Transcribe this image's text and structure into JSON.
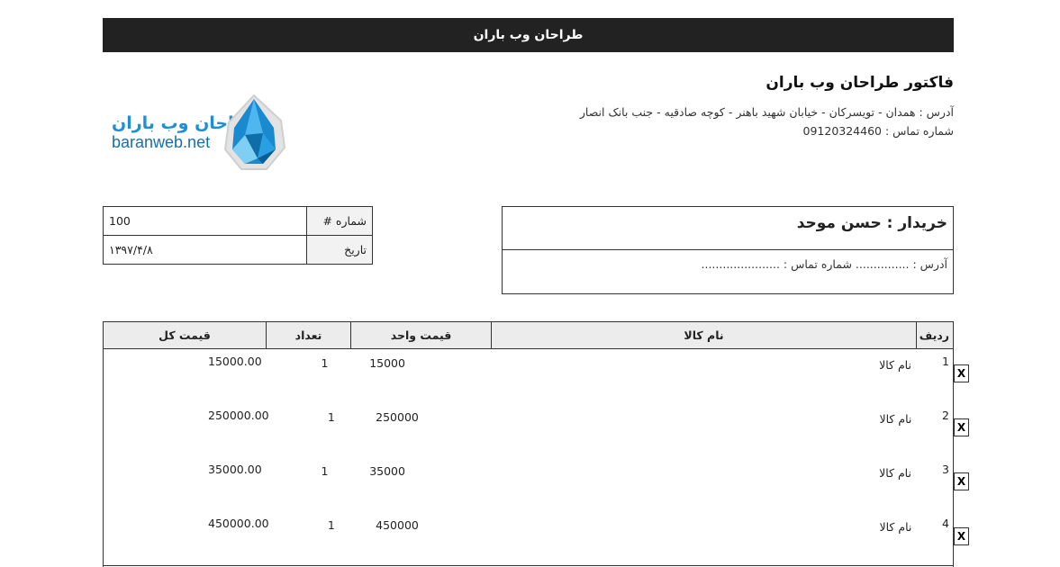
{
  "header": {
    "title": "طراحان وب باران"
  },
  "seller": {
    "title": "فاکتور طراحان وب باران",
    "address": "آدرس : همدان - تویسرکان - خیابان شهید باهنر - کوچه صادقیه - جنب بانک انصار",
    "phone": "شماره تماس : 09120324460"
  },
  "logo": {
    "brand_fa": "طراحان وب باران",
    "brand_en": "baranweb.net",
    "icon": "water-drop-icon",
    "color": "#1e8fd6"
  },
  "invoice_meta": [
    {
      "label": "شماره #",
      "value": "100"
    },
    {
      "label": "تاریخ",
      "value": "۱۳۹۷/۴/۸"
    }
  ],
  "buyer": {
    "name": "خریدار : حسن موحد",
    "address": "آدرس : ............... شماره تماس : ......................"
  },
  "items_table": {
    "columns": [
      "ردیف",
      "نام کالا",
      "قیمت واحد",
      "تعداد",
      "قیمت کل"
    ],
    "rows": [
      {
        "radif": "1",
        "name": "نام کالا",
        "unit_price": "15000",
        "qty": "1",
        "total": "15000.00",
        "delete": "X"
      },
      {
        "radif": "2",
        "name": "نام کالا",
        "unit_price": "250000",
        "qty": "1",
        "total": "250000.00",
        "delete": "X"
      },
      {
        "radif": "3",
        "name": "نام کالا",
        "unit_price": "35000",
        "qty": "1",
        "total": "35000.00",
        "delete": "X"
      },
      {
        "radif": "4",
        "name": "نام کالا",
        "unit_price": "450000",
        "qty": "1",
        "total": "450000.00",
        "delete": "X"
      }
    ]
  }
}
